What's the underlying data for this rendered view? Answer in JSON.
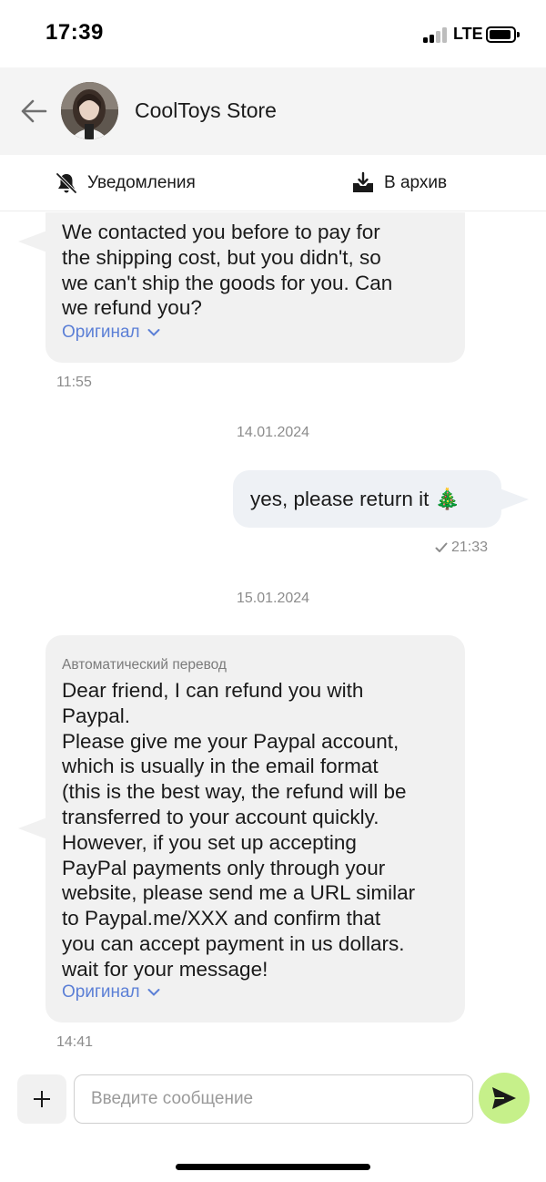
{
  "status_bar": {
    "time": "17:39",
    "network": "LTE",
    "battery_level": 0.8
  },
  "header": {
    "title": "CoolToys Store",
    "avatar_icon": "avatar-photo",
    "back_icon": "arrow-left-icon"
  },
  "actions": {
    "notifications_label": "Уведомления",
    "archive_label": "В архив"
  },
  "messages": [
    {
      "direction": "incoming",
      "text": "We contacted you before to pay for\nthe shipping cost, but you didn't, so\nwe can't ship the goods for you. Can\nwe refund you?",
      "original_label": "Оригинал",
      "time": "11:55"
    },
    {
      "type": "date",
      "text": "14.01.2024"
    },
    {
      "direction": "outgoing",
      "text": "yes, please return it 🎄",
      "time": "21:33",
      "status": "sent"
    },
    {
      "type": "date",
      "text": "15.01.2024"
    },
    {
      "direction": "incoming",
      "label": "Автоматический перевод",
      "text": "Dear friend, I can refund you with\nPaypal.\nPlease give me your Paypal account,\nwhich is usually in the email format\n(this is the best way, the refund will be\ntransferred to your account quickly.\nHowever, if you set up accepting\nPayPal payments only through your\nwebsite, please send me a URL similar\nto Paypal.me/XXX and confirm that\nyou can accept payment in us dollars.\nwait for your message!",
      "original_label": "Оригинал",
      "time": "14:41"
    }
  ],
  "composer": {
    "placeholder": "Введите сообщение",
    "value": ""
  },
  "colors": {
    "accent_link": "#5b7fd6",
    "send_button": "#c6f08a",
    "incoming_bubble": "#f1f1f1",
    "outgoing_bubble": "#eef1f5"
  }
}
